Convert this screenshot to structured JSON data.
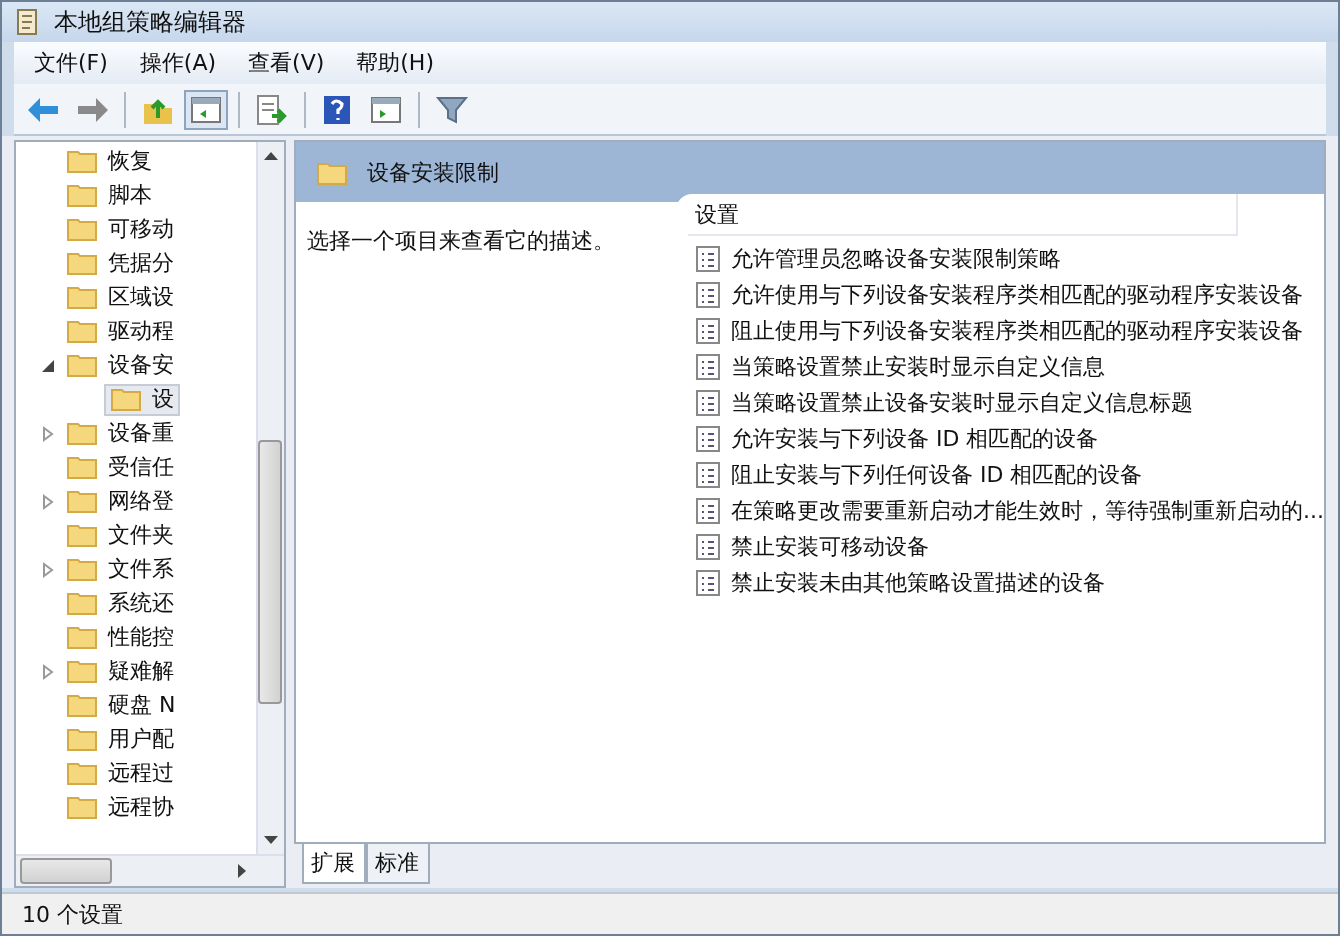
{
  "window": {
    "title": "本地组策略编辑器"
  },
  "menu": [
    "文件(F)",
    "操作(A)",
    "查看(V)",
    "帮助(H)"
  ],
  "toolbar": [
    {
      "kind": "back"
    },
    {
      "kind": "forward"
    },
    {
      "kind": "sep"
    },
    {
      "kind": "up"
    },
    {
      "kind": "pane",
      "selected": true
    },
    {
      "kind": "sep"
    },
    {
      "kind": "export"
    },
    {
      "kind": "sep"
    },
    {
      "kind": "help"
    },
    {
      "kind": "pane2",
      "selected": false
    },
    {
      "kind": "sep"
    },
    {
      "kind": "filter"
    }
  ],
  "tree": [
    {
      "label": "恢复",
      "expandable": false,
      "selected": false
    },
    {
      "label": "脚本",
      "expandable": false,
      "selected": false
    },
    {
      "label": "可移动",
      "expandable": false,
      "selected": false
    },
    {
      "label": "凭据分",
      "expandable": false,
      "selected": false
    },
    {
      "label": "区域设",
      "expandable": false,
      "selected": false
    },
    {
      "label": "驱动程",
      "expandable": false,
      "selected": false
    },
    {
      "label": "设备安",
      "expandable": true,
      "expanded": true,
      "selected": false,
      "children": [
        {
          "label": "设",
          "expandable": false,
          "selected": true
        }
      ]
    },
    {
      "label": "设备重",
      "expandable": true,
      "expanded": false,
      "selected": false
    },
    {
      "label": "受信任",
      "expandable": false,
      "selected": false
    },
    {
      "label": "网络登",
      "expandable": true,
      "expanded": false,
      "selected": false
    },
    {
      "label": "文件夹",
      "expandable": false,
      "selected": false
    },
    {
      "label": "文件系",
      "expandable": true,
      "expanded": false,
      "selected": false
    },
    {
      "label": "系统还",
      "expandable": false,
      "selected": false
    },
    {
      "label": "性能控",
      "expandable": false,
      "selected": false
    },
    {
      "label": "疑难解",
      "expandable": true,
      "expanded": false,
      "selected": false
    },
    {
      "label": "硬盘 N",
      "expandable": false,
      "selected": false
    },
    {
      "label": "用户配",
      "expandable": false,
      "selected": false
    },
    {
      "label": "远程过",
      "expandable": false,
      "selected": false
    },
    {
      "label": "远程协",
      "expandable": false,
      "selected": false
    }
  ],
  "header": {
    "title": "设备安装限制"
  },
  "description": "选择一个项目来查看它的描述。",
  "settings": {
    "column": "设置",
    "rows": [
      "允许管理员忽略设备安装限制策略",
      "允许使用与下列设备安装程序类相匹配的驱动程序安装设备",
      "阻止使用与下列设备安装程序类相匹配的驱动程序安装设备",
      "当策略设置禁止安装时显示自定义信息",
      "当策略设置禁止设备安装时显示自定义信息标题",
      "允许安装与下列设备 ID 相匹配的设备",
      "阻止安装与下列任何设备 ID 相匹配的设备",
      "在策略更改需要重新启动才能生效时，等待强制重新启动的...",
      "禁止安装可移动设备",
      "禁止安装未由其他策略设置描述的设备"
    ]
  },
  "tabs": [
    {
      "label": "扩展",
      "selected": true
    },
    {
      "label": "标准",
      "selected": false
    }
  ],
  "status_bar": "10 个设置"
}
